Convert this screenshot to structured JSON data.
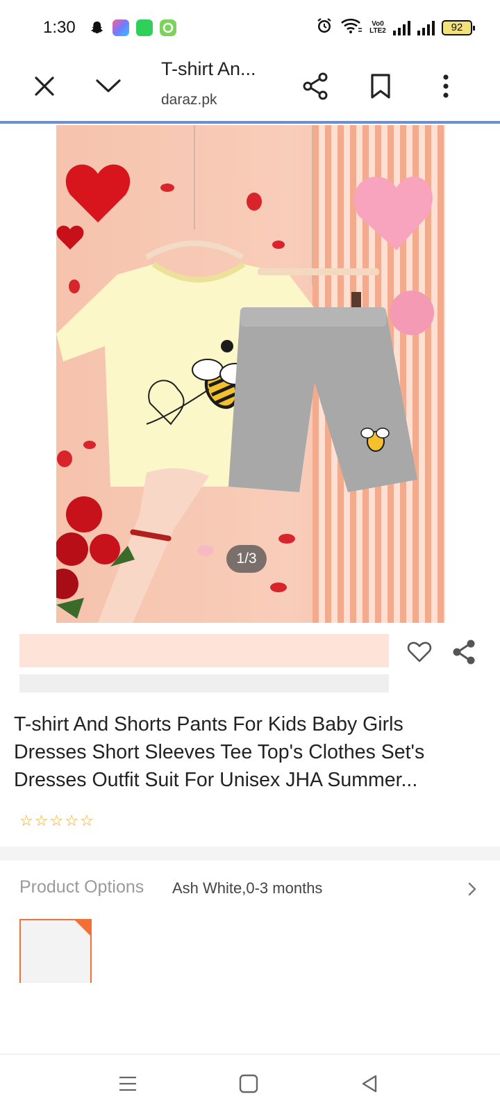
{
  "status_bar": {
    "time": "1:30",
    "battery_level": "92",
    "network_label": "Vo0 LTE2",
    "icons": [
      "snapchat-icon",
      "app-icon",
      "phone-manager-icon",
      "circle-app-icon",
      "alarm-icon",
      "wifi-icon",
      "signal-icon"
    ]
  },
  "toolbar": {
    "title": "T-shirt An...",
    "url": "daraz.pk",
    "close_icon": "close-icon",
    "minimize_icon": "chevron-down-icon",
    "share_icon": "share-icon",
    "bookmark_icon": "bookmark-icon",
    "menu_icon": "more-vertical-icon",
    "progress_color": "#6c8fd1"
  },
  "gallery": {
    "counter": "1/3"
  },
  "product": {
    "title": "T-shirt And Shorts Pants For Kids Baby Girls Dresses Short Sleeves Tee Top's Clothes Set's Dresses Outfit Suit For Unisex JHA Summer...",
    "rating_stars": 5,
    "rating_value": 0,
    "star_color": "#f5a623"
  },
  "options": {
    "label": "Product Options",
    "selected_value": "Ash White,0-3 months",
    "accent_color": "#f36f36"
  },
  "nav_bar": {
    "icons": [
      "recents-icon",
      "home-icon",
      "back-icon"
    ]
  }
}
